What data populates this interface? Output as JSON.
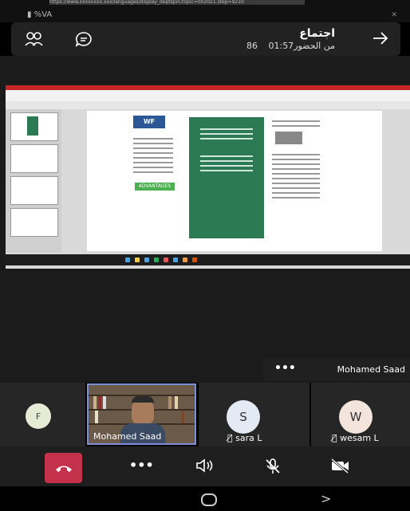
{
  "status": {
    "url": "https://www.xxxxxxxx.xxx/languages/display_deptspin.topic=002021.step=9210",
    "battery_text": "%VA"
  },
  "header": {
    "title": "اجتماع",
    "duration": "01:57",
    "attendees": "86 من الحضور"
  },
  "active_speaker": {
    "name": "Mohamed Saad"
  },
  "participants": [
    {
      "initial": "F",
      "name": ""
    },
    {
      "initial": "",
      "name": "Mohamed Saad"
    },
    {
      "initial": "S",
      "name": "sara L"
    },
    {
      "initial": "W",
      "name": "wesam L"
    }
  ],
  "slide": {
    "logo": "WF",
    "badge": "ADVANTAGES"
  },
  "colors": {
    "hangup": "#c4314b",
    "active_tile_border": "#7b8fd6",
    "slide_green": "#2b7a53"
  }
}
